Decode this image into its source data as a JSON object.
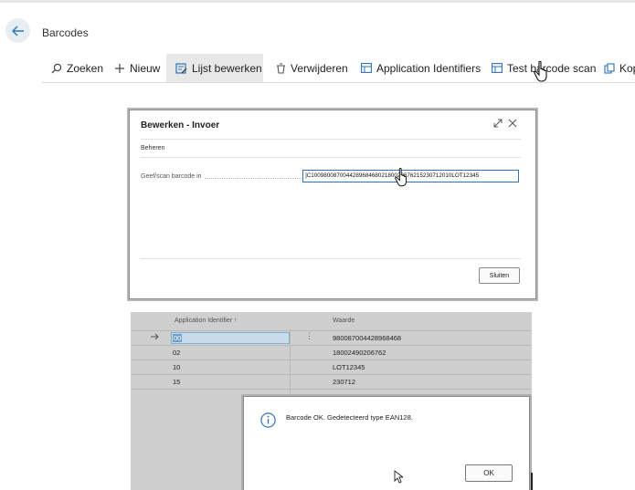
{
  "header": {
    "title": "Barcodes"
  },
  "actions": [
    {
      "label": "Zoeken",
      "icon": "search-icon"
    },
    {
      "label": "Nieuw",
      "icon": "plus-icon"
    },
    {
      "label": "Lijst bewerken",
      "icon": "edit-list-icon",
      "active": true
    },
    {
      "label": "Verwijderen",
      "icon": "trash-icon"
    },
    {
      "label": "Application Identifiers",
      "icon": "table-icon"
    },
    {
      "label": "Test barcode scan",
      "icon": "table-icon"
    },
    {
      "label": "Kop",
      "icon": "copy-icon"
    }
  ],
  "edit_dialog": {
    "title": "Bewerken - Invoer",
    "group": "Beheren",
    "field_label": "Geef/scan barcode in",
    "field_value": "]C10098008700442896846802180020676215230712010LOT12345",
    "close_label": "Sluiten"
  },
  "ai_table": {
    "columns": [
      "Application Identifier ↑",
      "Waarde"
    ],
    "rows": [
      {
        "ai": "00",
        "value": "980087004428968468",
        "selected": true
      },
      {
        "ai": "02",
        "value": "18002490206762"
      },
      {
        "ai": "10",
        "value": "LOT12345"
      },
      {
        "ai": "15",
        "value": "230712"
      }
    ]
  },
  "message_dialog": {
    "text": "Barcode OK. Gedetecteerd type EAN128.",
    "ok_label": "OK"
  },
  "colors": {
    "accent": "#2f73b6",
    "selection": "#c7dbe8"
  }
}
